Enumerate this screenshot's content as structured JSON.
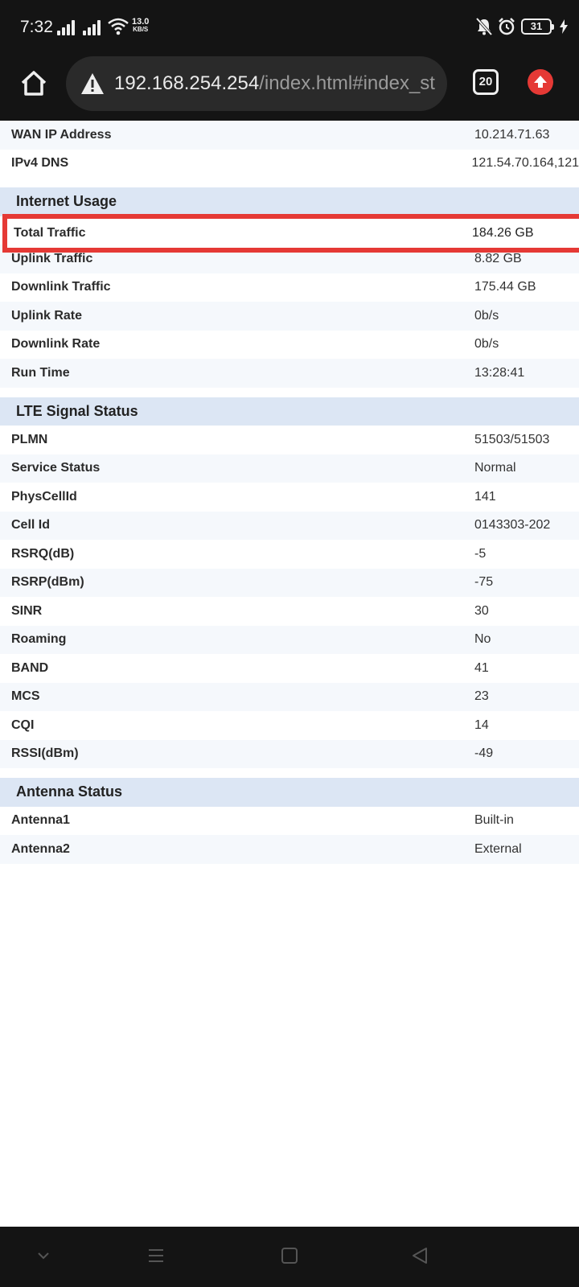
{
  "status_bar": {
    "time": "7:32",
    "net_speed_value": "13.0",
    "net_speed_unit": "KB/S",
    "battery": "31"
  },
  "browser": {
    "url_host": "192.168.254.254",
    "url_path": "/index.html#index_st",
    "tab_count": "20"
  },
  "top_rows": [
    {
      "label": "WAN IP Address",
      "value": "10.214.71.63"
    },
    {
      "label": "IPv4 DNS",
      "value": "121.54.70.164,121"
    }
  ],
  "internet_usage": {
    "title": "Internet Usage",
    "highlight": {
      "label": "Total Traffic",
      "value": "184.26 GB"
    },
    "rows": [
      {
        "label": "Uplink Traffic",
        "value": "8.82 GB"
      },
      {
        "label": "Downlink Traffic",
        "value": "175.44 GB"
      },
      {
        "label": "Uplink Rate",
        "value": "0b/s"
      },
      {
        "label": "Downlink Rate",
        "value": "0b/s"
      },
      {
        "label": "Run Time",
        "value": "13:28:41"
      }
    ]
  },
  "lte_signal": {
    "title": "LTE Signal Status",
    "rows": [
      {
        "label": "PLMN",
        "value": "51503/51503"
      },
      {
        "label": "Service Status",
        "value": "Normal"
      },
      {
        "label": "PhysCellId",
        "value": "141"
      },
      {
        "label": "Cell Id",
        "value": "0143303-202"
      },
      {
        "label": "RSRQ(dB)",
        "value": "-5"
      },
      {
        "label": "RSRP(dBm)",
        "value": "-75"
      },
      {
        "label": "SINR",
        "value": "30"
      },
      {
        "label": "Roaming",
        "value": "No"
      },
      {
        "label": "BAND",
        "value": "41"
      },
      {
        "label": "MCS",
        "value": "23"
      },
      {
        "label": "CQI",
        "value": "14"
      },
      {
        "label": "RSSI(dBm)",
        "value": "-49"
      }
    ]
  },
  "antenna": {
    "title": "Antenna Status",
    "rows": [
      {
        "label": "Antenna1",
        "value": "Built-in"
      },
      {
        "label": "Antenna2",
        "value": "External"
      }
    ]
  },
  "colors": {
    "highlight_border": "#e53935",
    "section_header_bg": "#dce6f4",
    "system_bar_bg": "#141414"
  }
}
